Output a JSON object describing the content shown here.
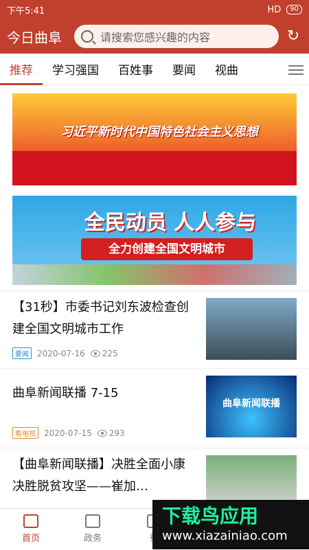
{
  "status": {
    "time": "下午5:41",
    "battery": "90",
    "signal": "HD"
  },
  "header": {
    "logo": "今日曲阜",
    "search_placeholder": "请搜索您感兴趣的内容"
  },
  "tabs": [
    "推荐",
    "学习强国",
    "百姓事",
    "要闻",
    "视曲"
  ],
  "banners": {
    "b1": "习近平新时代中国特色社会主义思想",
    "b2_title": "全民动员 人人参与",
    "b2_sub": "全力创建全国文明城市"
  },
  "news": [
    {
      "title": "【31秒】市委书记刘东波检查创建全国文明城市工作",
      "tag": "要闻",
      "date": "2020-07-16",
      "views": "225"
    },
    {
      "title": "曲阜新闻联播 7-15",
      "tag": "看电视",
      "date": "2020-07-15",
      "views": "293",
      "thumb_text": "曲阜新闻联播"
    },
    {
      "title": "【曲阜新闻联播】决胜全面小康 决胜脱贫攻坚——崔加…",
      "tag": "",
      "date": "",
      "views": ""
    }
  ],
  "bottomnav": [
    "首页",
    "政务",
    "微"
  ],
  "watermark": {
    "line1": "下载鸟应用",
    "line2": "www.xiazainiao.com"
  },
  "colors": {
    "brand": "#c1402d"
  }
}
